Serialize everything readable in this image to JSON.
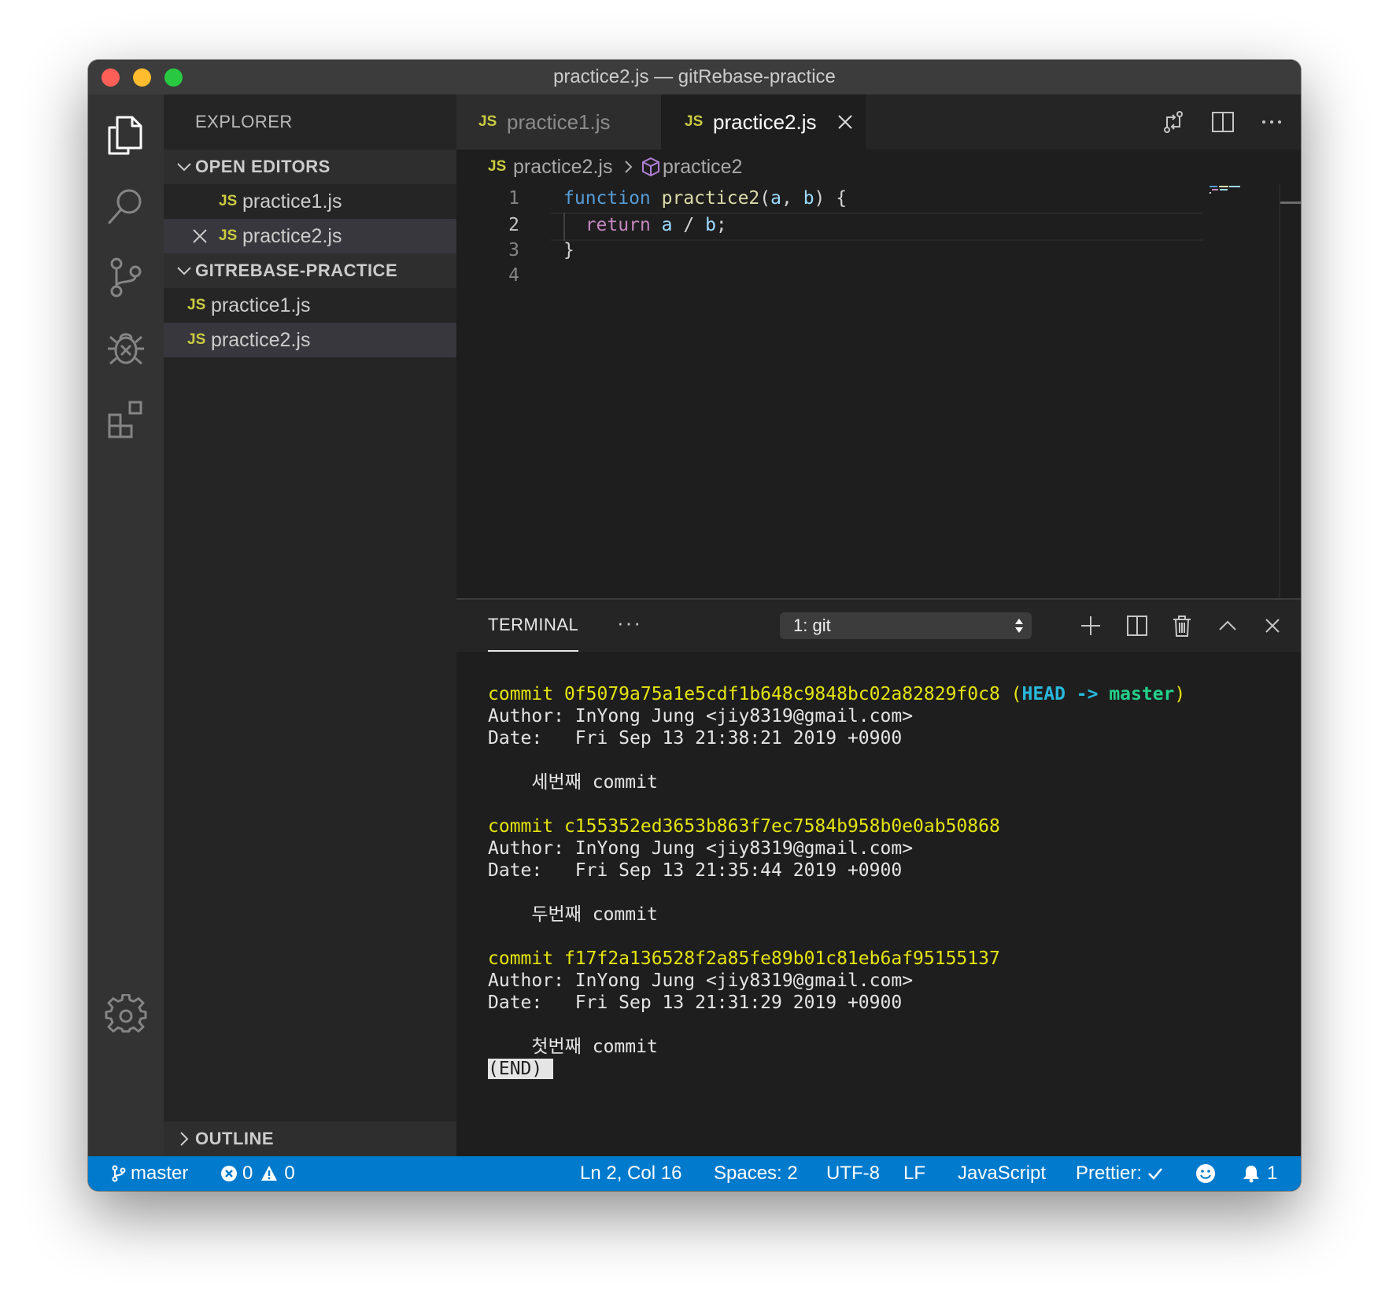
{
  "window": {
    "title": "practice2.js — gitRebase-practice"
  },
  "activity_bar": {
    "items": [
      "files-icon",
      "search-icon",
      "source-control-icon",
      "debug-icon",
      "extensions-icon"
    ],
    "bottom": "gear-icon"
  },
  "sidebar": {
    "title": "EXPLORER",
    "open_editors": {
      "label": "OPEN EDITORS",
      "badge": "JS",
      "items": [
        {
          "name": "practice1.js"
        },
        {
          "name": "practice2.js",
          "selected": true
        }
      ]
    },
    "project": {
      "label": "GITREBASE-PRACTICE",
      "badge": "JS",
      "items": [
        {
          "name": "practice1.js"
        },
        {
          "name": "practice2.js",
          "selected": true
        }
      ]
    },
    "outline": {
      "label": "OUTLINE"
    }
  },
  "editor": {
    "tabs": [
      {
        "badge": "JS",
        "label": "practice1.js",
        "active": false
      },
      {
        "badge": "JS",
        "label": "practice2.js",
        "active": true
      }
    ],
    "breadcrumbs": {
      "badge": "JS",
      "file": "practice2.js",
      "symbol": "practice2"
    },
    "line_numbers": [
      "1",
      "2",
      "3",
      "4"
    ],
    "code": {
      "l1_kw": "function",
      "l1_fn": "practice2",
      "l1_open": "(",
      "l1_a": "a",
      "l1_comma": ", ",
      "l1_b": "b",
      "l1_close": ") {",
      "l2_indent": "  ",
      "l2_kw": "return",
      "l2_a": "a",
      "l2_op": " / ",
      "l2_b": "b",
      "l2_end": ";",
      "l3": "}"
    }
  },
  "panel": {
    "tab": "TERMINAL",
    "more": "···",
    "selector": "1: git",
    "terminal": {
      "commits": [
        {
          "commit_label": "commit ",
          "hash": "0f5079a75a1e5cdf1b648c9848bc02a82829f0c8",
          "ref_open": " (",
          "ref_head": "HEAD -> ",
          "ref_branch": "master",
          "ref_close": ")",
          "author": "Author: InYong Jung <jiy8319@gmail.com>",
          "date": "Date:   Fri Sep 13 21:38:21 2019 +0900",
          "message": "    세번째 commit"
        },
        {
          "commit_label": "commit ",
          "hash": "c155352ed3653b863f7ec7584b958b0e0ab50868",
          "author": "Author: InYong Jung <jiy8319@gmail.com>",
          "date": "Date:   Fri Sep 13 21:35:44 2019 +0900",
          "message": "    두번째 commit"
        },
        {
          "commit_label": "commit ",
          "hash": "f17f2a136528f2a85fe89b01c81eb6af95155137",
          "author": "Author: InYong Jung <jiy8319@gmail.com>",
          "date": "Date:   Fri Sep 13 21:31:29 2019 +0900",
          "message": "    첫번째 commit"
        }
      ],
      "end_marker": "(END)"
    }
  },
  "status_bar": {
    "branch": "master",
    "errors": "0",
    "warnings": "0",
    "position": "Ln 2, Col 16",
    "spaces": "Spaces: 2",
    "encoding": "UTF-8",
    "eol": "LF",
    "language": "JavaScript",
    "prettier": "Prettier:",
    "notifications": "1"
  }
}
